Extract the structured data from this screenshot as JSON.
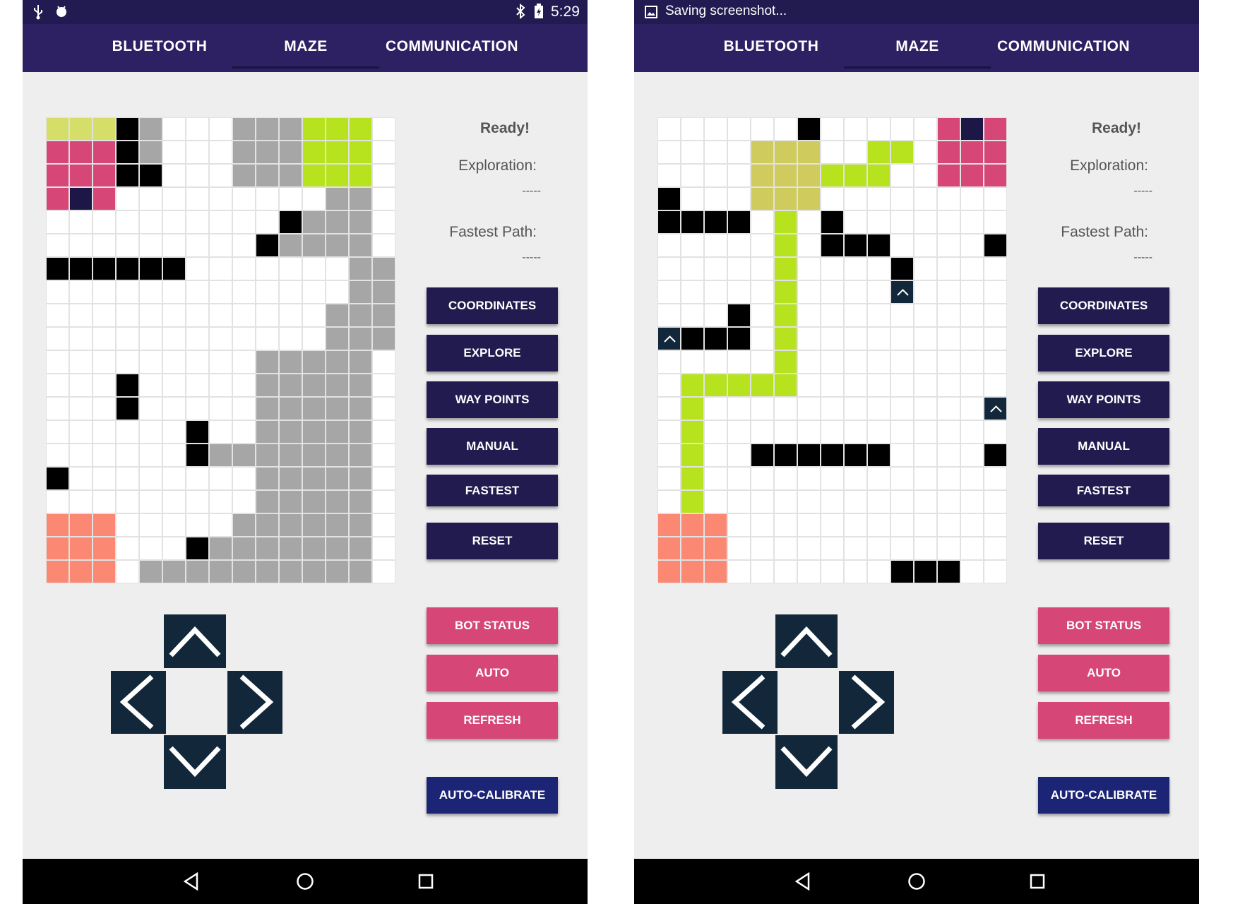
{
  "status_bar": {
    "time": "5:29",
    "saving_text": "Saving screenshot..."
  },
  "tabs": [
    "BLUETOOTH",
    "MAZE",
    "COMMUNICATION"
  ],
  "active_tab": "MAZE",
  "info": {
    "ready": "Ready!",
    "exploration_label": "Exploration:",
    "exploration_value": "-----",
    "fastest_label": "Fastest Path:",
    "fastest_value": "-----"
  },
  "buttons": {
    "coordinates": "COORDINATES",
    "explore": "EXPLORE",
    "way_points": "WAY POINTS",
    "manual": "MANUAL",
    "fastest": "FASTEST",
    "reset": "RESET",
    "bot_status": "BOT STATUS",
    "auto": "AUTO",
    "refresh": "REFRESH",
    "auto_calibrate": "AUTO-CALIBRATE"
  },
  "icons": {
    "usb": "usb-icon",
    "android": "android-debug-icon",
    "bluetooth": "bluetooth-icon",
    "battery": "battery-charging-icon",
    "screenshot": "image-icon",
    "back": "back-triangle-icon",
    "home": "home-circle-icon",
    "recents": "recents-square-icon",
    "up": "chevron-up-icon",
    "down": "chevron-down-icon",
    "left": "chevron-left-icon",
    "right": "chevron-right-icon"
  },
  "colors": {
    "tabbar": "#2e2163",
    "status_bar": "#221b52",
    "button_dark": "#221b4f",
    "button_pink": "#d64677",
    "button_navy": "#1c2475",
    "dpad": "#13273a",
    "cell_empty": "#ffffff",
    "cell_obstacle": "#000000",
    "cell_explored": "#a6a6a6",
    "cell_start": "#fa8872",
    "cell_goal_a": "#d6de6a",
    "cell_goal_b": "#b6e31e",
    "cell_robot": "#d64677",
    "cell_robot_head": "#1c1746",
    "cell_path": "#b6e31e",
    "cell_goal_khaki": "#cfcb5d",
    "cell_arrow_bg": "#13273a"
  },
  "maze_legend": {
    ".": "cell_empty",
    "#": "cell_obstacle",
    "g": "cell_explored",
    "s": "cell_start",
    "y": "cell_goal_a",
    "G": "cell_goal_b",
    "k": "cell_goal_khaki",
    "m": "cell_robot",
    "n": "cell_robot_head",
    "p": "cell_path",
    "^": "cell_arrow_bg"
  },
  "mazes": [
    {
      "rows": [
        "yyy#g...gggGGG",
        "mmm#g...gggGGG",
        "mmm##...gggGGG",
        "mnm.........gg",
        "..........#ggg",
        ".........#gggg",
        "######.......gg",
        ".............gg",
        "............ggg",
        "............ggg",
        ".........ggggg",
        "...#.....ggggg",
        "...#.....ggggg",
        "......#..ggggg",
        "......#ggggggg",
        "#........ggggg",
        ".........ggggg",
        "sss.....gggggg",
        "sss...#ggggggg",
        "sss.gggggggggg"
      ]
    },
    {
      "rows": [
        "......#.....mnm",
        "....kkk..pp.mmm",
        "....kkkppp..mmm",
        "#...kkk........",
        "####.p.#.......",
        ".....p.###....#",
        ".....p....#....",
        ".....p....^....",
        "...#.p.........",
        "^###.p.........",
        ".....p.........",
        ".ppppp.........",
        ".p............^",
        ".p.............#",
        ".p..######....#",
        ".p.............",
        ".p.............",
        "sss............",
        "sss............",
        "sss.......###.."
      ]
    }
  ]
}
